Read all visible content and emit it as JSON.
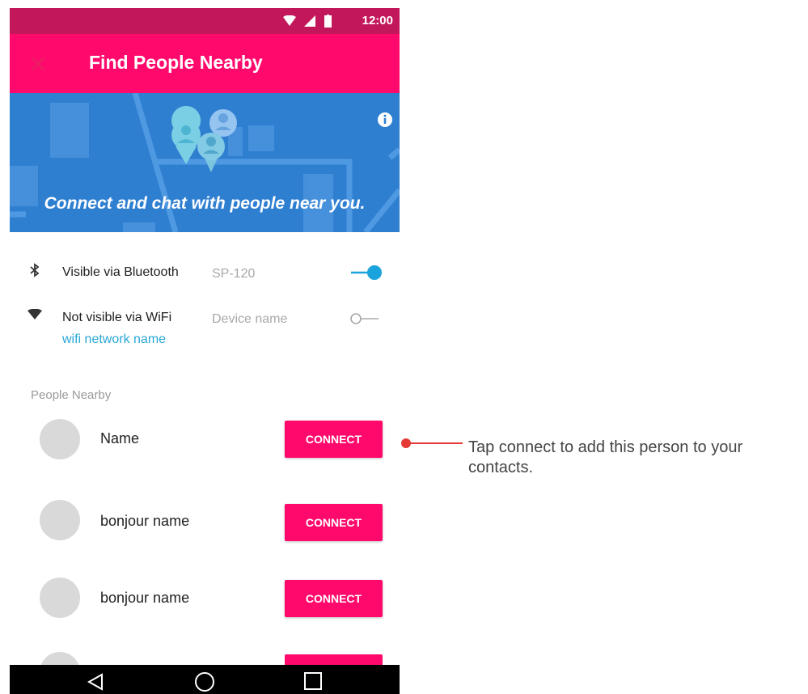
{
  "status_bar": {
    "time": "12:00"
  },
  "app_bar": {
    "title": "Find People Nearby",
    "close_icon": "close-icon"
  },
  "banner": {
    "tagline": "Connect and chat with people near you.",
    "info_icon": "info-icon"
  },
  "visibility": {
    "bluetooth": {
      "label": "Visible via Bluetooth",
      "device": "SP-120",
      "enabled": true,
      "icon": "bluetooth-icon"
    },
    "wifi": {
      "label": "Not visible via WiFi",
      "device_placeholder": "Device name",
      "network": "wifi network name",
      "enabled": false,
      "icon": "wifi-icon"
    }
  },
  "people": {
    "section_label": "People Nearby",
    "items": [
      {
        "name": "Name",
        "button": "CONNECT"
      },
      {
        "name": "bonjour name",
        "button": "CONNECT"
      },
      {
        "name": "bonjour name",
        "button": "CONNECT"
      }
    ]
  },
  "annotation": {
    "text": "Tap connect to add this person to your contacts."
  },
  "colors": {
    "primary": "#ff0a6c",
    "status_bar": "#c2185b",
    "banner": "#2f7fd1",
    "toggle_on": "#1aa3dd",
    "annotation": "#e53935"
  }
}
